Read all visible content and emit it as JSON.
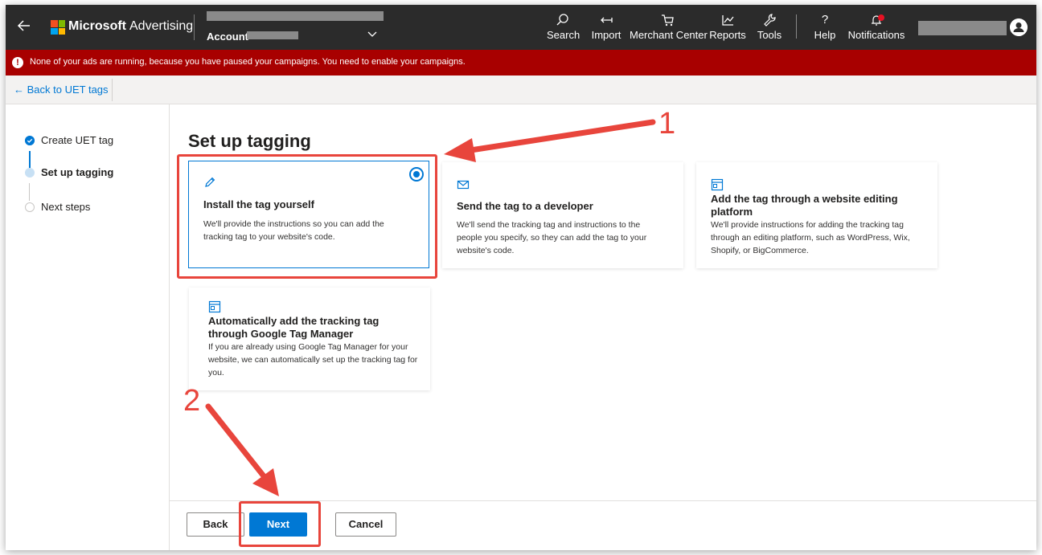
{
  "header": {
    "brand_name": "Microsoft",
    "brand_product": "Advertising",
    "account_label": "Account",
    "nav": [
      {
        "label": "Search",
        "icon": "search-icon"
      },
      {
        "label": "Import",
        "icon": "import-icon"
      },
      {
        "label": "Merchant Center",
        "icon": "cart-icon"
      },
      {
        "label": "Reports",
        "icon": "chart-icon"
      },
      {
        "label": "Tools",
        "icon": "wrench-icon"
      },
      {
        "label": "Help",
        "icon": "help-icon"
      },
      {
        "label": "Notifications",
        "icon": "bell-icon"
      }
    ]
  },
  "banner": {
    "text": "None of your ads are running, because you have paused your campaigns. You need to enable your campaigns."
  },
  "backbar": {
    "back_label": "← Back to UET tags"
  },
  "steps": [
    {
      "label": "Create UET tag",
      "state": "complete"
    },
    {
      "label": "Set up tagging",
      "state": "current"
    },
    {
      "label": "Next steps",
      "state": "upcoming"
    }
  ],
  "main": {
    "title": "Set up tagging",
    "options": [
      {
        "title": "Install the tag yourself",
        "description": "We'll provide the instructions so you can add the tracking tag to your website's code.",
        "icon": "pencil-icon",
        "selected": true
      },
      {
        "title": "Send the tag to a developer",
        "description": "We'll send the tracking tag and instructions to the people you specify, so they can add the tag to your website's code.",
        "icon": "mail-icon",
        "selected": false
      },
      {
        "title": "Add the tag through a website editing platform",
        "description": "We'll provide instructions for adding the tracking tag through an editing platform, such as WordPress, Wix, Shopify, or BigCommerce.",
        "icon": "browser-window-icon",
        "selected": false
      },
      {
        "title": "Automatically add the tracking tag through Google Tag Manager",
        "description": "If you are already using Google Tag Manager for your website, we can automatically set up the tracking tag for you.",
        "icon": "browser-window-icon",
        "selected": false
      }
    ]
  },
  "footer": {
    "back_label": "Back",
    "next_label": "Next",
    "cancel_label": "Cancel"
  },
  "annotations": {
    "marker_1": "1",
    "marker_2": "2",
    "color": "#e8453c"
  },
  "colors": {
    "accent": "#0078d4",
    "banner": "#a80000",
    "header": "#2b2b2b"
  }
}
